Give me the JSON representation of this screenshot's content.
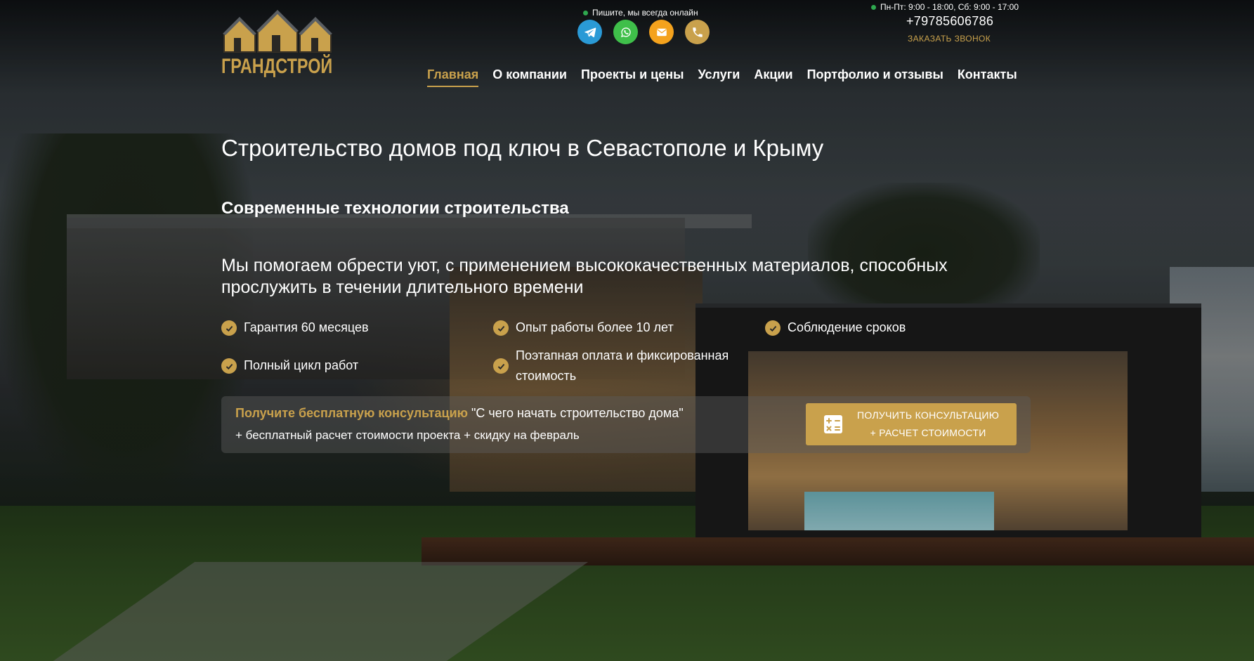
{
  "brand": {
    "logo_text": "ГРАНДСТРОЙ",
    "accent_color": "#c9a14c"
  },
  "header": {
    "online_text": "Пишите, мы всегда онлайн",
    "hours_text": "Пн-Пт: 9:00 - 18:00, Сб: 9:00 - 17:00",
    "phone": "+79785606786",
    "callback_label": "ЗАКАЗАТЬ ЗВОНОК",
    "socials": [
      {
        "icon": "telegram-icon",
        "color": "#2a9ad6"
      },
      {
        "icon": "whatsapp-icon",
        "color": "#3fbf4a"
      },
      {
        "icon": "email-icon",
        "color": "#f4a21d"
      },
      {
        "icon": "phone-icon",
        "color": "#c9a14c"
      }
    ]
  },
  "nav": {
    "items": [
      {
        "label": "Главная",
        "active": true
      },
      {
        "label": "О компании"
      },
      {
        "label": "Проекты и цены"
      },
      {
        "label": "Услуги"
      },
      {
        "label": "Акции"
      },
      {
        "label": "Портфолио и отзывы"
      },
      {
        "label": "Контакты"
      }
    ]
  },
  "hero": {
    "title": "Строительство домов под ключ в Севастополе и Крыму",
    "subtitle": "Современные технологии строительства",
    "lead": "Мы помогаем обрести уют, с применением высококачественных материалов, способных прослужить в течении длительного времени",
    "features": [
      "Гарантия 60 месяцев",
      "Опыт работы более 10 лет",
      "Соблюдение сроков",
      "Полный цикл работ",
      "Поэтапная оплата и фиксированная стоимость"
    ]
  },
  "consult": {
    "strong_text": "Получите бесплатную консультацию",
    "quote_text": "\"С чего начать строительство дома\"",
    "line2": "+ бесплатный расчет стоимости проекта + скидку на февраль",
    "cta_line1": "ПОЛУЧИТЬ КОНСУЛЬТАЦИЮ",
    "cta_line2": "+ РАСЧЕТ СТОИМОСТИ",
    "cta_icon": "calculator-icon"
  }
}
